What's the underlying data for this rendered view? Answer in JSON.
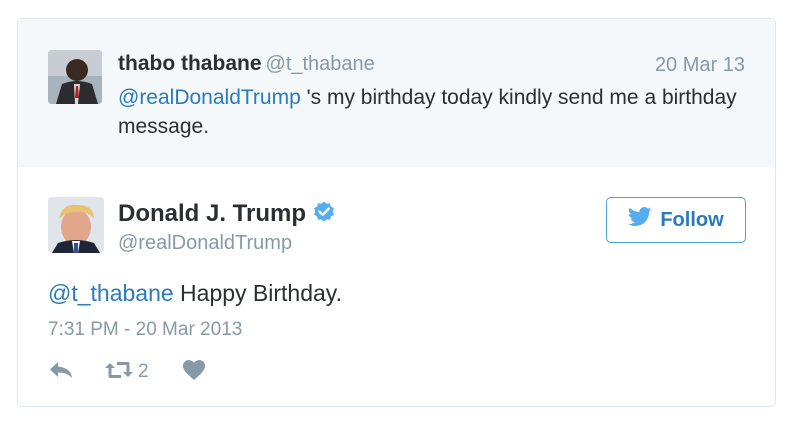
{
  "parent_tweet": {
    "name": "thabo thabane",
    "handle": "@t_thabane",
    "date": "20 Mar 13",
    "mention": "@realDonaldTrump",
    "text": " 's my birthday today kindly send me a birthday message."
  },
  "tweet": {
    "name": "Donald J. Trump",
    "handle": "@realDonaldTrump",
    "follow_label": "Follow",
    "mention": "@t_thabane",
    "text": " Happy Birthday.",
    "timestamp": "7:31 PM - 20 Mar 2013",
    "retweet_count": "2"
  },
  "colors": {
    "link": "#2b7bb9",
    "muted": "#8899a6",
    "parent_bg": "#f5f8fa",
    "border": "#e1e8ed"
  },
  "icons": {
    "verified": "verified-badge-icon",
    "bird": "twitter-bird-icon",
    "reply": "reply-icon",
    "retweet": "retweet-icon",
    "like": "heart-icon"
  }
}
